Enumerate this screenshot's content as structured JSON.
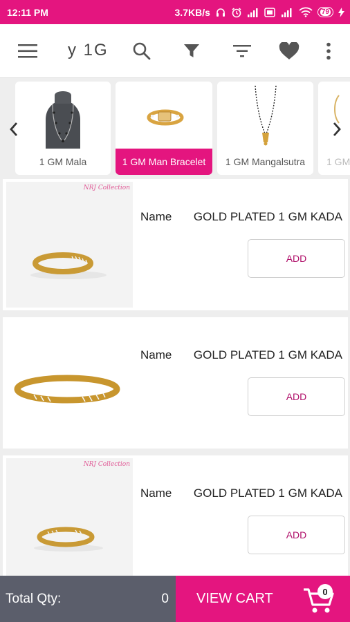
{
  "status_bar": {
    "time": "12:11 PM",
    "net_speed": "3.7KB/s",
    "battery": "79"
  },
  "app_bar": {
    "marquee_text": "y 1G",
    "icons": [
      "menu-icon",
      "search-icon",
      "filter-icon",
      "sort-icon",
      "heart-icon",
      "more-vert-icon"
    ]
  },
  "categories": {
    "items": [
      {
        "label": "1 GM Mala"
      },
      {
        "label": "1 GM Man Bracelet"
      },
      {
        "label": "1 GM Mangalsutra"
      },
      {
        "label": "1 GM"
      }
    ],
    "active_index": 1
  },
  "products": [
    {
      "name_label": "Name",
      "name_value": "GOLD PLATED 1 GM KADA",
      "add_label": "ADD",
      "brand": "NRJ Collection"
    },
    {
      "name_label": "Name",
      "name_value": "GOLD PLATED 1 GM KADA",
      "add_label": "ADD",
      "brand": ""
    },
    {
      "name_label": "Name",
      "name_value": "GOLD PLATED 1 GM KADA",
      "add_label": "ADD",
      "brand": "NRJ Collection"
    }
  ],
  "bottom_bar": {
    "total_qty_label": "Total Qty:",
    "total_qty_value": "0",
    "view_cart_label": "VIEW CART",
    "cart_badge": "0"
  },
  "colors": {
    "accent": "#e4157f",
    "bottom_left": "#5b5e6b",
    "add_text": "#b0106a"
  }
}
